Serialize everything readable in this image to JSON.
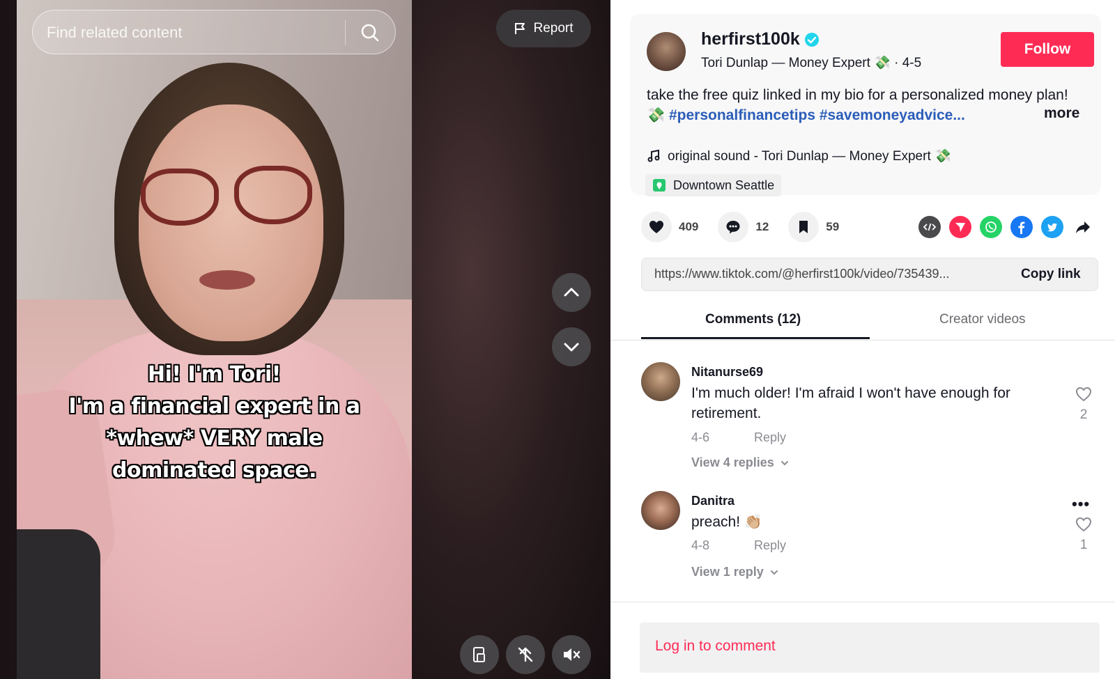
{
  "search": {
    "placeholder": "Find related content"
  },
  "report": {
    "label": "Report"
  },
  "video": {
    "caption_lines": [
      "Hi! I'm Tori!",
      "I'm a financial expert in a",
      "*whew* VERY male",
      "dominated space."
    ]
  },
  "author": {
    "username": "herfirst100k",
    "display_line": "Tori Dunlap — Money Expert 💸 · 4-5",
    "follow_label": "Follow"
  },
  "description": {
    "text": "take the free quiz linked in my bio for a personalized money plan! 💸 ",
    "hashtags": "#personalfinancetips #savemoneyadvice...",
    "more_label": "more"
  },
  "sound": {
    "label": "original sound - Tori Dunlap — Money Expert 💸"
  },
  "location": {
    "label": "Downtown Seattle"
  },
  "stats": {
    "likes": "409",
    "comments": "12",
    "saves": "59"
  },
  "link": {
    "url": "https://www.tiktok.com/@herfirst100k/video/735439...",
    "copy_label": "Copy link"
  },
  "tabs": {
    "comments": "Comments (12)",
    "creator_videos": "Creator videos"
  },
  "comments": [
    {
      "name": "Nitanurse69",
      "text": "I'm much older! I'm afraid I won't have enough for retirement.",
      "date": "4-6",
      "reply": "Reply",
      "view_replies": "View 4 replies",
      "likes": "2"
    },
    {
      "name": "Danitra",
      "text": "preach! 👏🏼",
      "date": "4-8",
      "reply": "Reply",
      "view_replies": "View 1 reply",
      "likes": "1",
      "more": "•••"
    }
  ],
  "login": {
    "label": "Log in to comment"
  },
  "colors": {
    "accent": "#fe2c55",
    "hashtag": "#2b5db9",
    "verified": "#20d5ec"
  }
}
